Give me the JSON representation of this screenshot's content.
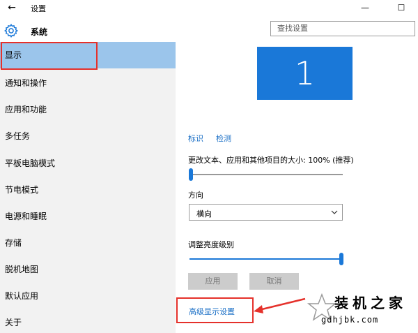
{
  "window": {
    "title": "设置",
    "back_icon": "back-arrow-icon",
    "minimize_glyph": "—",
    "maximize_glyph": "☐"
  },
  "header": {
    "section_title": "系统",
    "section_icon": "gear-icon"
  },
  "search": {
    "placeholder": "查找设置"
  },
  "sidebar": {
    "items": [
      {
        "label": "显示",
        "selected": true
      },
      {
        "label": "通知和操作",
        "selected": false
      },
      {
        "label": "应用和功能",
        "selected": false
      },
      {
        "label": "多任务",
        "selected": false
      },
      {
        "label": "平板电脑模式",
        "selected": false
      },
      {
        "label": "节电模式",
        "selected": false
      },
      {
        "label": "电源和睡眠",
        "selected": false
      },
      {
        "label": "存储",
        "selected": false
      },
      {
        "label": "脱机地图",
        "selected": false
      },
      {
        "label": "默认应用",
        "selected": false
      },
      {
        "label": "关于",
        "selected": false
      }
    ]
  },
  "display": {
    "monitor_number": "1",
    "identify_label": "标识",
    "detect_label": "检测",
    "scale_label": "更改文本、应用和其他项目的大小: 100% (推荐)",
    "scale_value_fraction": 0.0,
    "orientation_label": "方向",
    "orientation_value": "横向",
    "brightness_label": "调整亮度级别",
    "brightness_value_fraction": 1.0,
    "apply_label": "应用",
    "cancel_label": "取消",
    "advanced_link": "高级显示设置"
  },
  "watermark": {
    "title": "装机之家",
    "url": "gdhjbk.com"
  },
  "colors": {
    "accent": "#1a78d8",
    "selected_nav": "#9bc5eb",
    "sidebar_bg": "#f2f2f2",
    "annotation_red": "#e5312b",
    "link": "#1a6fc6"
  }
}
